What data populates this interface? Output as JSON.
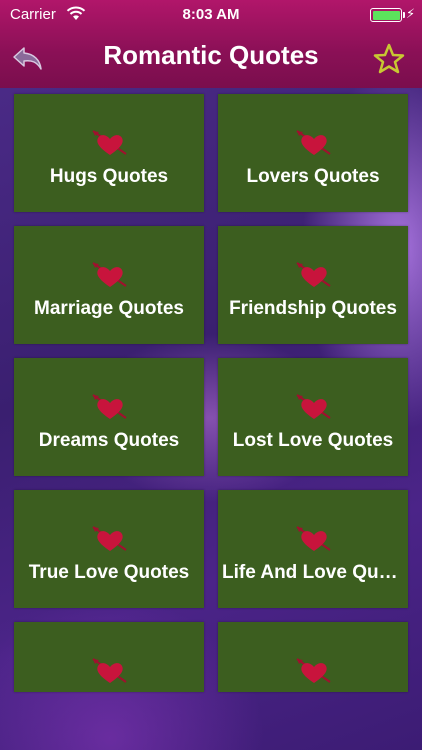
{
  "status_bar": {
    "carrier": "Carrier",
    "time": "8:03 AM"
  },
  "header": {
    "title": "Romantic Quotes",
    "back_icon": "back-arrow-icon",
    "star_icon": "star-icon"
  },
  "colors": {
    "header": "#9a1260",
    "tile": "#3c5e1f",
    "heart": "#c8143c",
    "star": "#c8c832",
    "background": "#4a2a86"
  },
  "tiles": [
    {
      "label": "Hugs Quotes",
      "icon": "heart-arrow-icon"
    },
    {
      "label": "Lovers Quotes",
      "icon": "heart-arrow-icon"
    },
    {
      "label": "Marriage Quotes",
      "icon": "heart-arrow-icon"
    },
    {
      "label": "Friendship Quotes",
      "icon": "heart-arrow-icon"
    },
    {
      "label": "Dreams Quotes",
      "icon": "heart-arrow-icon"
    },
    {
      "label": "Lost Love Quotes",
      "icon": "heart-arrow-icon"
    },
    {
      "label": "True Love Quotes",
      "icon": "heart-arrow-icon"
    },
    {
      "label": "Life And Love Quotes",
      "icon": "heart-arrow-icon"
    },
    {
      "label": "",
      "icon": "heart-arrow-icon"
    },
    {
      "label": "",
      "icon": "heart-arrow-icon"
    }
  ]
}
